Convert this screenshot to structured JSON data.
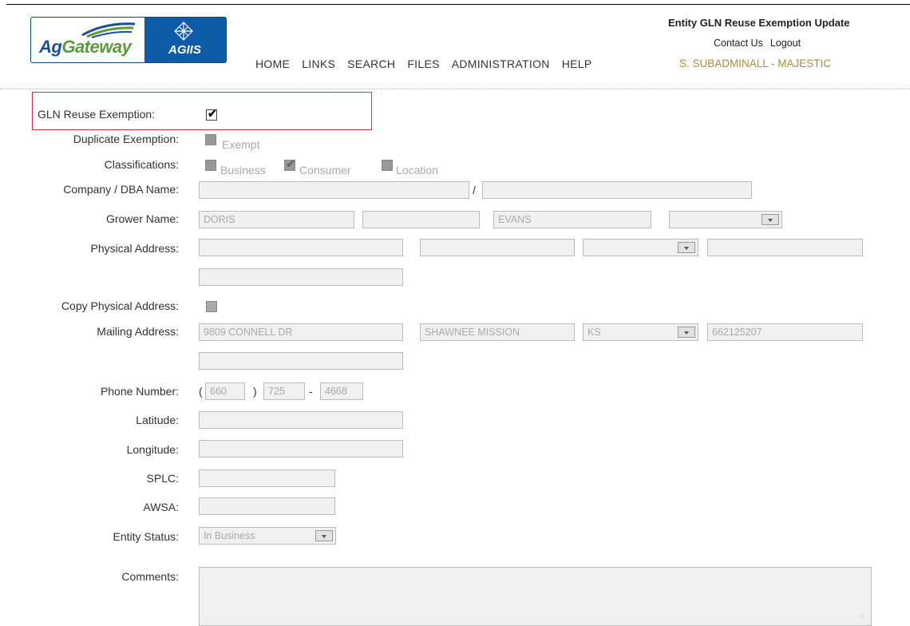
{
  "header": {
    "logo_text_left": "Ag",
    "logo_text_right": "Gateway",
    "logo_sub": "AGIIS",
    "nav": [
      "HOME",
      "LINKS",
      "SEARCH",
      "FILES",
      "ADMINISTRATION",
      "HELP"
    ],
    "page_title": "Entity GLN Reuse Exemption Update",
    "contact_us": "Contact Us",
    "logout": "Logout",
    "user": "S. SUBADMINALL - MAJESTIC"
  },
  "form": {
    "gln_reuse_label": "GLN Reuse Exemption:",
    "gln_reuse_checked": true,
    "duplicate_label": "Duplicate Exemption:",
    "duplicate_option": "Exempt",
    "classifications_label": "Classifications:",
    "classifications": [
      {
        "label": "Business",
        "checked": false
      },
      {
        "label": "Consumer",
        "checked": true
      },
      {
        "label": "Location",
        "checked": false
      }
    ],
    "company_label": "Company / DBA Name:",
    "company_separator": "/",
    "company_name": "",
    "dba_name": "",
    "grower_label": "Grower Name:",
    "grower_first": "DORIS",
    "grower_middle": "",
    "grower_last": "EVANS",
    "grower_suffix": "",
    "physical_label": "Physical Address:",
    "physical_line1": "",
    "physical_city": "",
    "physical_state": "",
    "physical_zip": "",
    "physical_line2": "",
    "copy_physical_label": "Copy Physical Address:",
    "mailing_label": "Mailing Address:",
    "mailing_line1": "9809 CONNELL DR",
    "mailing_city": "SHAWNEE MISSION",
    "mailing_state": "KS",
    "mailing_zip": "662125207",
    "mailing_line2": "",
    "phone_label": "Phone Number:",
    "phone_open": "(",
    "phone_close": ")",
    "phone_dash": "-",
    "phone_area": "660",
    "phone_prefix": "725",
    "phone_line": "4668",
    "latitude_label": "Latitude:",
    "latitude": "",
    "longitude_label": "Longitude:",
    "longitude": "",
    "splc_label": "SPLC:",
    "splc": "",
    "awsa_label": "AWSA:",
    "awsa": "",
    "entity_status_label": "Entity Status:",
    "entity_status": "In Business",
    "comments_label": "Comments:",
    "comments": ""
  },
  "colors": {
    "highlight_border": "#e0313b",
    "user_text": "#b08a3e",
    "logo_blue": "#0e5ca8"
  }
}
